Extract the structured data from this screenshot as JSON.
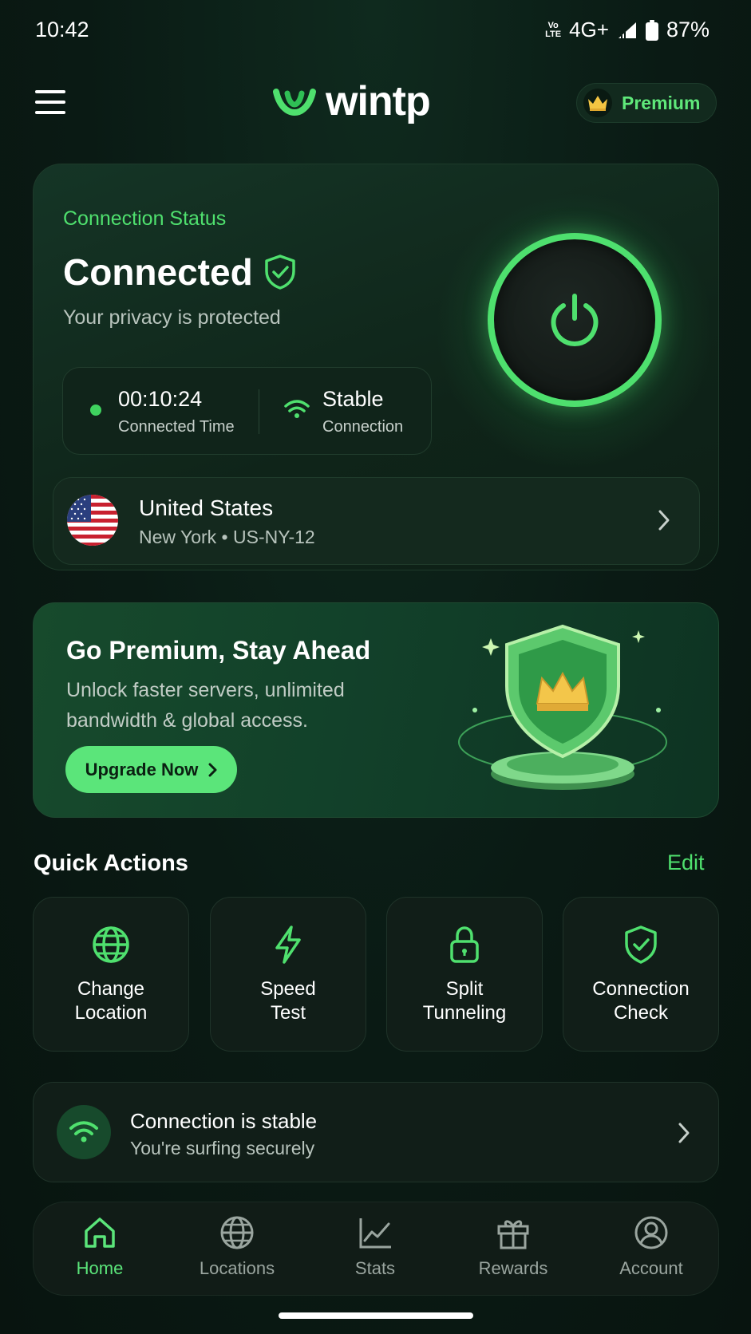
{
  "status_bar": {
    "time": "10:42",
    "volte": "Vo LTE",
    "network": "4G+",
    "battery": "87%"
  },
  "header": {
    "logo_text": "wintp",
    "premium_label": "Premium",
    "accent_color": "#5be57a"
  },
  "connection": {
    "status_label": "Connection Status",
    "state": "Connected",
    "subtitle": "Your privacy is protected",
    "connected_time_value": "00:10:24",
    "connected_time_label": "Connected Time",
    "quality_value": "Stable",
    "quality_label": "Connection",
    "location": {
      "country": "United States",
      "detail": "New York • US-NY-12",
      "flag": "us-flag"
    }
  },
  "promo": {
    "title": "Go Premium, Stay Ahead",
    "text": "Unlock faster servers, unlimited bandwidth & global access.",
    "button_label": "Upgrade Now"
  },
  "quick_actions": {
    "title": "Quick Actions",
    "edit_label": "Edit",
    "items": [
      {
        "label": "Change\nLocation",
        "icon": "globe-icon"
      },
      {
        "label": "Speed\nTest",
        "icon": "bolt-icon"
      },
      {
        "label": "Split\nTunneling",
        "icon": "lock-icon"
      },
      {
        "label": "Connection\nCheck",
        "icon": "shield-check-icon"
      }
    ]
  },
  "stable_banner": {
    "title": "Connection is stable",
    "subtitle": "You're surfing securely"
  },
  "bottom_nav": {
    "items": [
      {
        "label": "Home",
        "icon": "home-icon",
        "active": true
      },
      {
        "label": "Locations",
        "icon": "globe-icon",
        "active": false
      },
      {
        "label": "Stats",
        "icon": "chart-icon",
        "active": false
      },
      {
        "label": "Rewards",
        "icon": "gift-icon",
        "active": false
      },
      {
        "label": "Account",
        "icon": "user-icon",
        "active": false
      }
    ]
  }
}
